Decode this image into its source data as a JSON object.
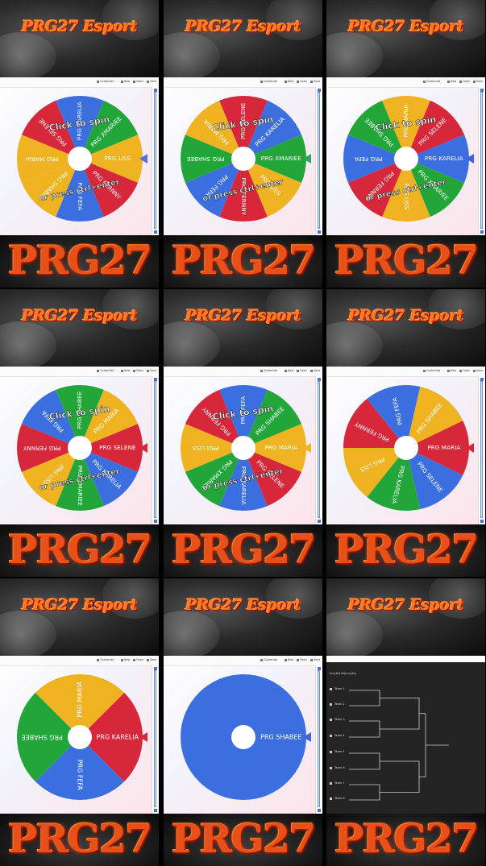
{
  "top_logo_text": "PRG27 Esport",
  "bottom_logo_text": "PRG27",
  "toolbar": {
    "customize": "Customize",
    "new": "New",
    "open": "Open",
    "save": "Save"
  },
  "colors": {
    "red": "#d7273a",
    "blue": "#3b6fe0",
    "green": "#22a63a",
    "yellow": "#efb321",
    "pointer": "#3f63d6"
  },
  "overlay": {
    "click_to_spin": "Click to spin",
    "or_press": "or press ctrl+enter"
  },
  "panels": [
    {
      "type": "wheel",
      "overlay": true,
      "pointer": "#5a6fd8",
      "slices": [
        {
          "label": "PRG LISS",
          "color": "yellow"
        },
        {
          "label": "PRG FERNNY",
          "color": "red"
        },
        {
          "label": "PRG FEFA",
          "color": "blue"
        },
        {
          "label": "PRG SHABEE",
          "color": "yellow"
        },
        {
          "label": "PRG MARIA",
          "color": "yellow"
        },
        {
          "label": "PRG SELENE",
          "color": "red"
        },
        {
          "label": "PRG KARELIA",
          "color": "blue"
        },
        {
          "label": "PRG XMARIEE",
          "color": "green"
        }
      ]
    },
    {
      "type": "wheel",
      "overlay": true,
      "pointer": "#2fa35a",
      "slices": [
        {
          "label": "PRG XMARIEE",
          "color": "green"
        },
        {
          "label": "PRG LISS",
          "color": "yellow"
        },
        {
          "label": "PRG FERNNY",
          "color": "red"
        },
        {
          "label": "PRG FEFA",
          "color": "blue"
        },
        {
          "label": "PRG SHABEE",
          "color": "green"
        },
        {
          "label": "PRG MARIA",
          "color": "yellow"
        },
        {
          "label": "PRG SELENE",
          "color": "red"
        },
        {
          "label": "PRG KARELIA",
          "color": "blue"
        }
      ]
    },
    {
      "type": "wheel",
      "overlay": true,
      "pointer": "#3f63d6",
      "slices": [
        {
          "label": "PRG KARELIA",
          "color": "blue"
        },
        {
          "label": "PRG XMARIEE",
          "color": "green"
        },
        {
          "label": "PRG LISS",
          "color": "yellow"
        },
        {
          "label": "PRG FERNNY",
          "color": "red"
        },
        {
          "label": "PRG FEFA",
          "color": "blue"
        },
        {
          "label": "PRG SHABEE",
          "color": "green"
        },
        {
          "label": "PRG MARIA",
          "color": "yellow"
        },
        {
          "label": "PRG SELENE",
          "color": "red"
        }
      ]
    },
    {
      "type": "wheel",
      "overlay": true,
      "pointer": "#d7273a",
      "slices": [
        {
          "label": "PRG SELENE",
          "color": "red"
        },
        {
          "label": "PRG KARELIA",
          "color": "blue"
        },
        {
          "label": "PRG XMARIEE",
          "color": "green"
        },
        {
          "label": "PRG LISS",
          "color": "yellow"
        },
        {
          "label": "PRG FERNNY",
          "color": "red"
        },
        {
          "label": "PRG FEFA",
          "color": "blue"
        },
        {
          "label": "PRG SHABEE",
          "color": "green"
        },
        {
          "label": "PRG MARIA",
          "color": "yellow"
        }
      ]
    },
    {
      "type": "wheel",
      "overlay": true,
      "pointer": "#efb321",
      "slices": [
        {
          "label": "PRG MARIA",
          "color": "yellow"
        },
        {
          "label": "PRG SELENE",
          "color": "red"
        },
        {
          "label": "PRG KARELIA",
          "color": "blue"
        },
        {
          "label": "PRG XMARIEE",
          "color": "green"
        },
        {
          "label": "PRG LISS",
          "color": "yellow"
        },
        {
          "label": "PRG FERNNY",
          "color": "red"
        },
        {
          "label": "PRG FEFA",
          "color": "blue"
        },
        {
          "label": "PRG SHABEE",
          "color": "green"
        }
      ]
    },
    {
      "type": "wheel",
      "overlay": false,
      "pointer": "#d7273a",
      "slices": [
        {
          "label": "PRG MARIA",
          "color": "red"
        },
        {
          "label": "PRG SELENE",
          "color": "blue"
        },
        {
          "label": "PRG KARELIA",
          "color": "green"
        },
        {
          "label": "PRG LISS",
          "color": "yellow"
        },
        {
          "label": "PRG FERNNY",
          "color": "red"
        },
        {
          "label": "PRG FEFA",
          "color": "blue"
        },
        {
          "label": "PRG SHABEE",
          "color": "yellow"
        }
      ]
    },
    {
      "type": "wheel",
      "overlay": false,
      "pointer": "#d7273a",
      "slices": [
        {
          "label": "PRG KARELIA",
          "color": "red"
        },
        {
          "label": "PRG FEFA",
          "color": "blue"
        },
        {
          "label": "PRG SHABEE",
          "color": "green"
        },
        {
          "label": "PRG MARIA",
          "color": "yellow"
        }
      ]
    },
    {
      "type": "wheel",
      "overlay": false,
      "pointer": "#3f63d6",
      "slices": [
        {
          "label": "PRG SHABEE",
          "color": "blue"
        }
      ]
    },
    {
      "type": "bracket",
      "title": "bracket title (auto)",
      "teams": [
        "Team 1",
        "Team 2",
        "Team 3",
        "Team 4",
        "Team 5",
        "Team 6",
        "Team 7",
        "Team 8"
      ]
    }
  ]
}
